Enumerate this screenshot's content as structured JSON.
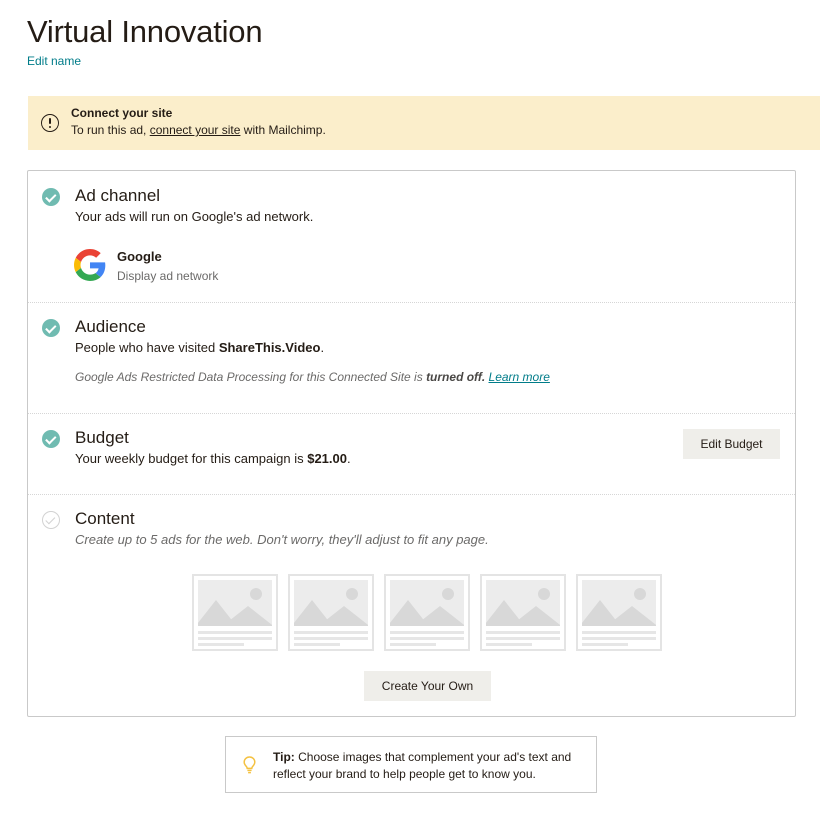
{
  "page": {
    "title": "Virtual Innovation",
    "edit_name_label": "Edit name"
  },
  "alert": {
    "icon": "warning-circle-icon",
    "title": "Connect your site",
    "text_before": "To run this ad, ",
    "link_text": "connect your site",
    "text_after": " with Mailchimp."
  },
  "sections": {
    "ad_channel": {
      "title": "Ad channel",
      "description": "Your ads will run on Google's ad network.",
      "status": "complete",
      "provider": {
        "icon": "google-logo",
        "name": "Google",
        "subtitle": "Display ad network"
      }
    },
    "audience": {
      "title": "Audience",
      "description_before": "People who have visited ",
      "site_name": "ShareThis.Video",
      "description_after": ".",
      "status": "complete",
      "note_before": "Google Ads Restricted Data Processing for this Connected Site is ",
      "note_bold": "turned off.",
      "note_link": "Learn more"
    },
    "budget": {
      "title": "Budget",
      "description_before": "Your weekly budget for this campaign is ",
      "amount": "$21.00",
      "description_after": ".",
      "status": "complete",
      "button_label": "Edit Budget"
    },
    "content": {
      "title": "Content",
      "description": "Create up to 5 ads for the web. Don't worry, they'll adjust to fit any page.",
      "status": "incomplete",
      "ad_placeholders": 5,
      "button_label": "Create Your Own"
    }
  },
  "tip": {
    "icon": "lightbulb-icon",
    "label": "Tip:",
    "text": " Choose images that complement your ad's text and reflect your brand to help people get to know you."
  },
  "colors": {
    "accent_teal": "#007c89",
    "check_green": "#70bbb1",
    "alert_bg": "#fbeecb",
    "button_bg": "#efeeea",
    "tip_bulb": "#f4c141"
  }
}
